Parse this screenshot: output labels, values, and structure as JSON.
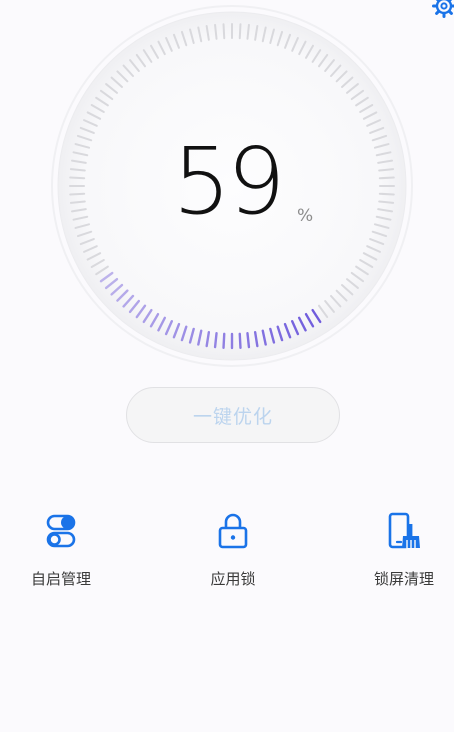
{
  "accent_color": "#1a73e8",
  "gauge": {
    "percent": 59,
    "value": "59",
    "unit": "%"
  },
  "optimize_button": {
    "label": "一键优化"
  },
  "settings": {
    "icon": "gear-icon"
  },
  "tools": [
    {
      "label": "自启管理",
      "icon": "toggle-switches-icon"
    },
    {
      "label": "应用锁",
      "icon": "padlock-icon"
    },
    {
      "label": "锁屏清理",
      "icon": "phone-broom-icon"
    }
  ]
}
